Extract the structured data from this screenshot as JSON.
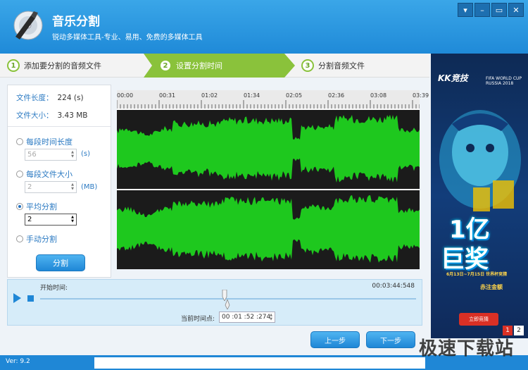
{
  "app": {
    "title": "音乐分割",
    "subtitle": "锐动多媒体工具-专业、易用、免费的多媒体工具"
  },
  "window_controls": [
    "menu-icon",
    "minimize-icon",
    "maximize-icon",
    "close-icon"
  ],
  "steps": [
    {
      "num": "1",
      "label": "添加要分割的音频文件"
    },
    {
      "num": "2",
      "label": "设置分割时间"
    },
    {
      "num": "3",
      "label": "分割音频文件"
    }
  ],
  "file_info": {
    "length_label": "文件长度：",
    "length_value": "224 (s)",
    "size_label": "文件大小：",
    "size_value": "3.43 MB"
  },
  "split_options": {
    "by_time": {
      "label": "每段时间长度",
      "value": "56",
      "unit": "(s)"
    },
    "by_size": {
      "label": "每段文件大小",
      "value": "2",
      "unit": "(MB)"
    },
    "average": {
      "label": "平均分割",
      "value": "2"
    },
    "manual": {
      "label": "手动分割"
    },
    "selected": "average"
  },
  "split_button": "分割",
  "timeline_ticks": [
    "00:00",
    "00:31",
    "01:02",
    "01:34",
    "02:05",
    "02:36",
    "03:08",
    "03:39"
  ],
  "playback": {
    "start_label": "开始时间:",
    "end_time": "00:03:44:548",
    "current_label": "当前时间点:",
    "current_value": "00 :01 :52 :274",
    "position": 0.5
  },
  "nav": {
    "prev": "上一步",
    "next": "下一步"
  },
  "ad": {
    "brand": "KK竞技",
    "event": "FIFA WORLD CUP RUSSIA 2018",
    "headline1": "1亿",
    "headline2": "巨奖",
    "dates": "6月13日~7月15日  世界杯竞猜",
    "gold": "赤注金额",
    "cta": "立即竞猜",
    "pages": [
      "1",
      "2"
    ]
  },
  "footer": {
    "version": "Ver: 9.2"
  },
  "watermark": "极速下载站",
  "colors": {
    "accent": "#1f87d6",
    "wave": "#1ec81e",
    "step_active": "#8ac23b"
  }
}
